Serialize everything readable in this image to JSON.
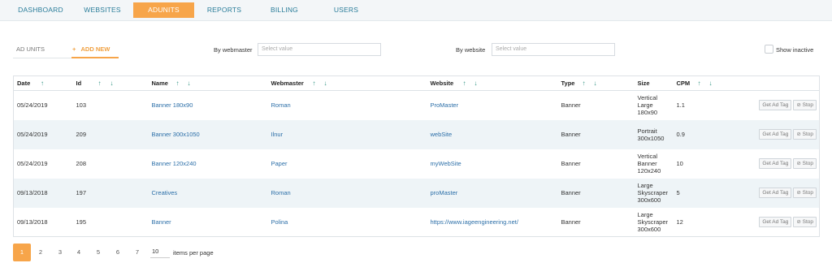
{
  "nav": {
    "tabs": [
      {
        "label": "DASHBOARD"
      },
      {
        "label": "WEBSITES"
      },
      {
        "label": "ADUNITS"
      },
      {
        "label": "REPORTS"
      },
      {
        "label": "BILLING"
      },
      {
        "label": "USERS"
      }
    ],
    "active": "ADUNITS"
  },
  "subtabs": {
    "ad_units": "AD UNITS",
    "add_new": "ADD NEW",
    "plus": "+"
  },
  "filters": {
    "webmaster_label": "By webmaster",
    "webmaster_placeholder": "Select value",
    "website_label": "By website",
    "website_placeholder": "Select value",
    "show_inactive": "Show inactive"
  },
  "table": {
    "headers": [
      "Date",
      "Id",
      "Name",
      "Webmaster",
      "Website",
      "Type",
      "Size",
      "CPM"
    ],
    "sort_up": "↑",
    "sort_down": "↓",
    "rows": [
      {
        "date": "05/24/2019",
        "id": "103",
        "name": "Banner 180x90",
        "webmaster": "Roman",
        "website": "ProMaster",
        "type": "Banner",
        "size": [
          "Vertical",
          "Large",
          "180x90"
        ],
        "cpm": "1.1"
      },
      {
        "date": "05/24/2019",
        "id": "209",
        "name": "Banner 300x1050",
        "webmaster": "Ilnur",
        "website": "webSite",
        "type": "Banner",
        "size": [
          "Portrait",
          "300x1050"
        ],
        "cpm": "0.9"
      },
      {
        "date": "05/24/2019",
        "id": "208",
        "name": "Banner 120x240",
        "webmaster": "Paper",
        "website": "myWebSite",
        "type": "Banner",
        "size": [
          "Vertical",
          "Banner",
          "120x240"
        ],
        "cpm": "10"
      },
      {
        "date": "09/13/2018",
        "id": "197",
        "name": "Creatives",
        "webmaster": "Roman",
        "website": "proMaster",
        "type": "Banner",
        "size": [
          "Large",
          "Skyscraper",
          "300x600"
        ],
        "cpm": "5"
      },
      {
        "date": "09/13/2018",
        "id": "195",
        "name": "Banner",
        "webmaster": "Polina",
        "website": "https://www.iageengineering.net/",
        "type": "Banner",
        "size": [
          "Large",
          "Skyscraper",
          "300x600"
        ],
        "cpm": "12"
      }
    ],
    "get_tag_label": "Get Ad Tag",
    "stop_label": "Stop",
    "stop_icon": "⊘"
  },
  "pagination": {
    "pages": [
      "1",
      "2",
      "3",
      "4",
      "5",
      "6",
      "7"
    ],
    "current": "1",
    "per_page": "10",
    "per_page_label": "items per page"
  }
}
